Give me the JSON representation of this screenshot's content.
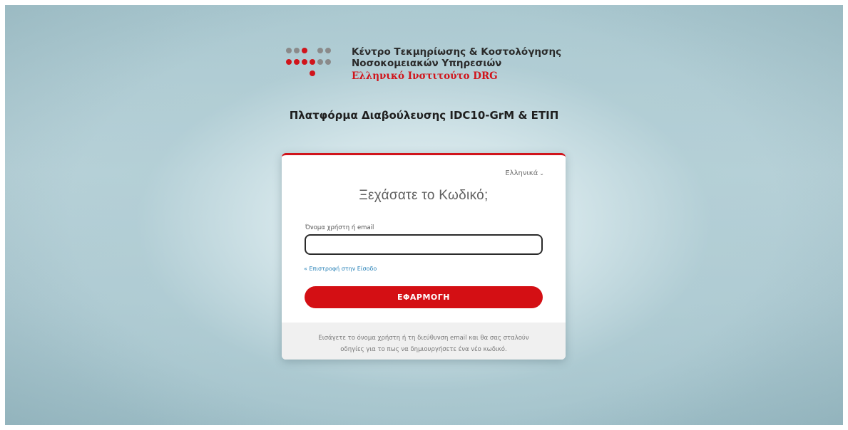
{
  "logo": {
    "line1": "Κέντρο Τεκμηρίωσης & Κοστολόγησης",
    "line2": "Νοσοκομειακών Υπηρεσιών",
    "line3": "Ελληνικό Ινστιτούτο DRG",
    "colors": {
      "brand_red": "#d0141b",
      "dot_gray": "#8a8a8a"
    }
  },
  "platform_title": "Πλατφόρμα Διαβούλευσης IDC10-GrM & ΕΤΙΠ",
  "card": {
    "language": "Ελληνικά",
    "language_icon": "chevron-down-icon",
    "title": "Ξεχάσατε το Κωδικό;",
    "field_label": "Όνομα χρήστη ή email",
    "field_value": "",
    "back_link": "« Επιστροφή στην Είσοδο",
    "submit_label": "ΕΦΑΡΜΟΓΗ",
    "help_line1": "Εισάγετε το όνομα χρήστη ή τη διεύθυνση email και θα σας σταλούν",
    "help_line2": "οδηγίες για το πως να δημιουργήσετε ένα νέο κωδικό.",
    "accent_color": "#d40f14"
  }
}
